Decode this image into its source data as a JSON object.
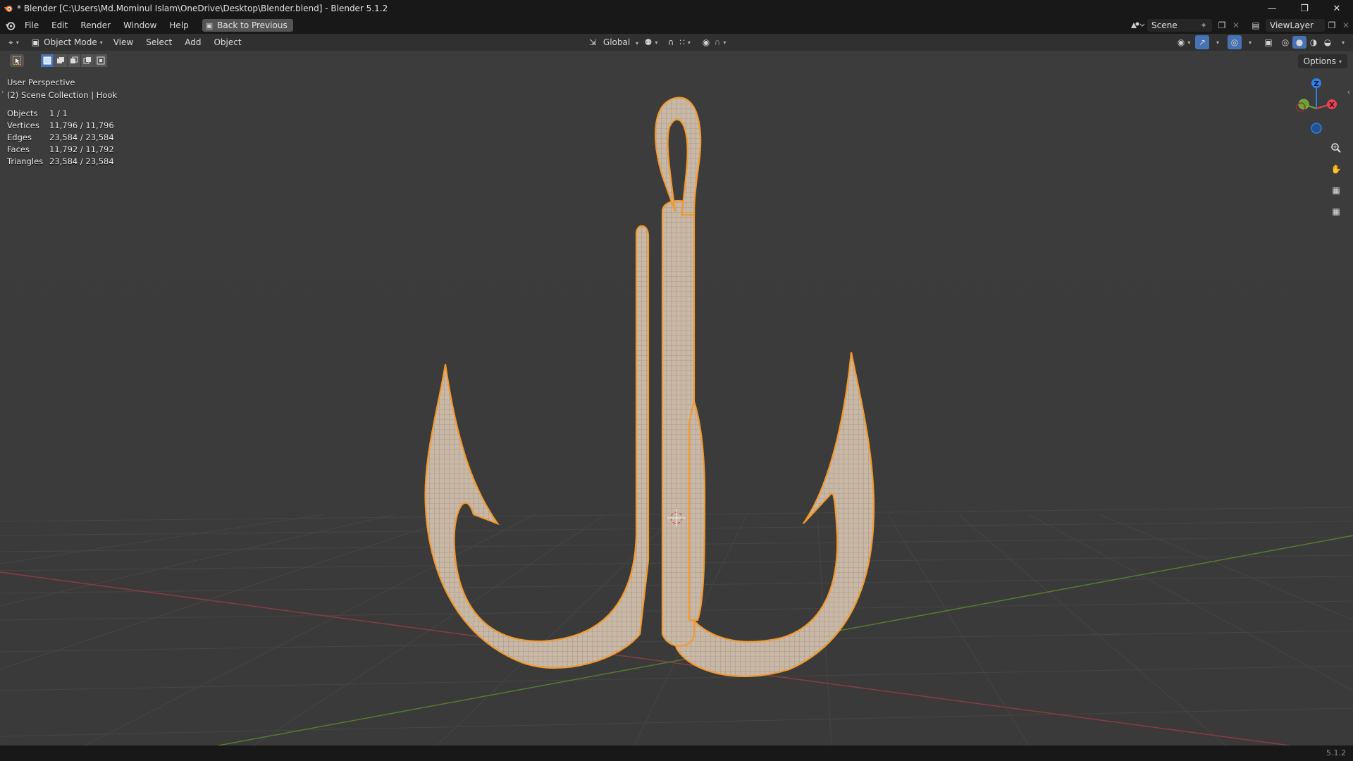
{
  "window": {
    "title": "* Blender [C:\\Users\\Md.Mominul Islam\\OneDrive\\Desktop\\Blender.blend] - Blender 5.1.2"
  },
  "menubar": {
    "items": [
      "File",
      "Edit",
      "Render",
      "Window",
      "Help"
    ],
    "back_button": "Back to Previous",
    "scene": "Scene",
    "view_layer": "ViewLayer"
  },
  "viewport_header": {
    "mode": "Object Mode",
    "menus": [
      "View",
      "Select",
      "Add",
      "Object"
    ],
    "orientation": "Global"
  },
  "toolbar": {
    "options": "Options"
  },
  "overlay": {
    "perspective": "User Perspective",
    "collection": "(2) Scene Collection | Hook",
    "stats": [
      {
        "label": "Objects",
        "value": "1 / 1"
      },
      {
        "label": "Vertices",
        "value": "11,796 / 11,796"
      },
      {
        "label": "Edges",
        "value": "23,584 / 23,584"
      },
      {
        "label": "Faces",
        "value": "11,792 / 11,792"
      },
      {
        "label": "Triangles",
        "value": "23,584 / 23,584"
      }
    ]
  },
  "gizmo": {
    "z_label": "Z",
    "x_label": "X",
    "colors": {
      "x": "#e64455",
      "y": "#6ca52d",
      "z": "#2f7fe6"
    }
  },
  "statusbar": {
    "version": "5.1.2"
  },
  "colors": {
    "selection": "#f29a2e",
    "object": "#c9b8a6",
    "grid": "#474747"
  }
}
